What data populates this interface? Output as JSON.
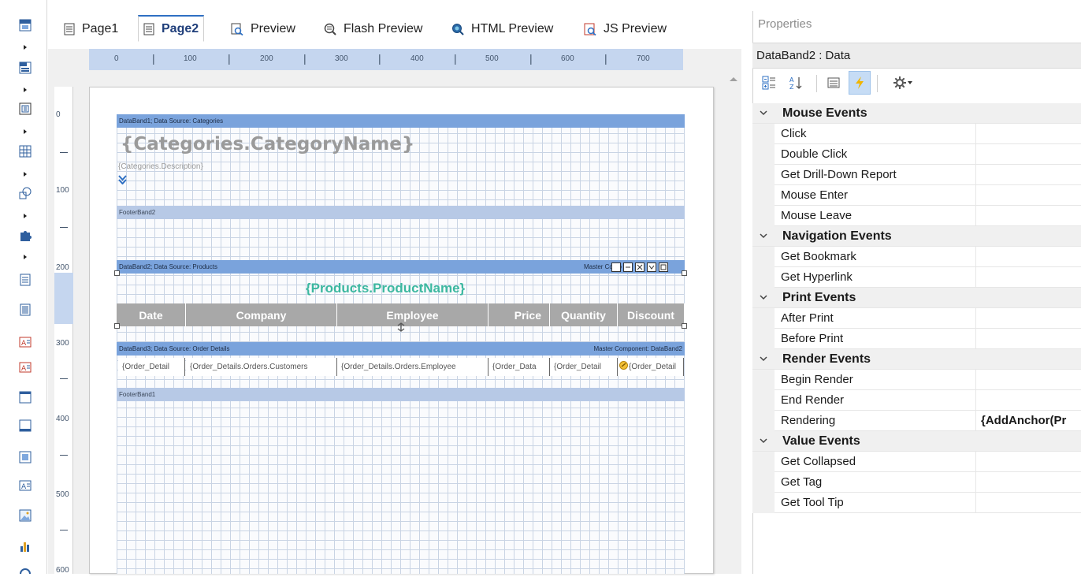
{
  "tabs": [
    {
      "label": "Page1",
      "icon": "page-icon"
    },
    {
      "label": "Page2",
      "icon": "page-icon",
      "active": true
    },
    {
      "label": "Preview",
      "icon": "preview-icon"
    },
    {
      "label": "Flash Preview",
      "icon": "flash-preview-icon"
    },
    {
      "label": "HTML Preview",
      "icon": "html-preview-icon"
    },
    {
      "label": "JS Preview",
      "icon": "js-preview-icon"
    }
  ],
  "ruler": {
    "horizontal": [
      "0",
      "100",
      "200",
      "300",
      "400",
      "500",
      "600",
      "700"
    ],
    "vertical": [
      "0",
      "100",
      "200",
      "300",
      "400",
      "500",
      "600"
    ]
  },
  "report": {
    "databand1": "DataBand1; Data Source: Categories",
    "category_name": "{Categories.CategoryName}",
    "category_desc": "{Categories.Description}",
    "footerband2": "FooterBand2",
    "databand2": "DataBand2; Data Source: Products",
    "databand2_master": "Master Comp",
    "product_name": "{Products.ProductName}",
    "headers": [
      "Date",
      "Company",
      "Employee",
      "Price",
      "Quantity",
      "Discount"
    ],
    "databand3": "DataBand3; Data Source: Order Details",
    "databand3_master": "Master Component: DataBand2",
    "cells": [
      "{Order_Detail",
      "{Order_Details.Orders.Customers",
      "{Order_Details.Orders.Employee",
      "{Order_Data",
      "{Order_Detail",
      "{Order_Detail"
    ],
    "footerband1": "FooterBand1"
  },
  "properties": {
    "title": "Properties",
    "selected": "DataBand2 : Data",
    "categories": [
      {
        "name": "Mouse  Events",
        "items": [
          {
            "name": "Click",
            "value": ""
          },
          {
            "name": "Double Click",
            "value": ""
          },
          {
            "name": "Get Drill-Down Report",
            "value": ""
          },
          {
            "name": "Mouse Enter",
            "value": ""
          },
          {
            "name": "Mouse Leave",
            "value": ""
          }
        ]
      },
      {
        "name": "Navigation  Events",
        "items": [
          {
            "name": "Get Bookmark",
            "value": ""
          },
          {
            "name": "Get Hyperlink",
            "value": ""
          }
        ]
      },
      {
        "name": "Print  Events",
        "items": [
          {
            "name": "After Print",
            "value": ""
          },
          {
            "name": "Before Print",
            "value": ""
          }
        ]
      },
      {
        "name": "Render  Events",
        "items": [
          {
            "name": "Begin Render",
            "value": ""
          },
          {
            "name": "End Render",
            "value": ""
          },
          {
            "name": "Rendering",
            "value": "{AddAnchor(Pr"
          }
        ]
      },
      {
        "name": "Value  Events",
        "items": [
          {
            "name": "Get Collapsed",
            "value": ""
          },
          {
            "name": "Get Tag",
            "value": ""
          },
          {
            "name": "Get Tool Tip",
            "value": ""
          }
        ]
      }
    ]
  },
  "colors": {
    "accent": "#2f70c3",
    "band_header": "#7aa3dc",
    "band_footer": "#b7c9e6",
    "product_name": "#3cb8a0",
    "table_header": "#a8a8a8"
  }
}
